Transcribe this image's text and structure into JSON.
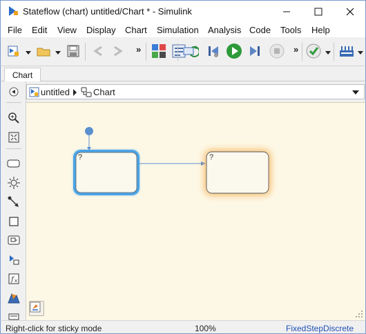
{
  "window": {
    "title": "Stateflow (chart) untitled/Chart * - Simulink",
    "icon": "stateflow-app-icon",
    "controls": [
      "minimize-icon",
      "maximize-icon",
      "close-icon"
    ]
  },
  "menu": {
    "items": [
      "File",
      "Edit",
      "View",
      "Display",
      "Chart",
      "Simulation",
      "Analysis",
      "Code",
      "Tools",
      "Help"
    ]
  },
  "toolbar": {
    "buttons": [
      "new-model-icon",
      "open-folder-icon",
      "save-icon",
      "back-arrow-icon",
      "forward-arrow-icon",
      "library-browser-icon",
      "model-explorer-icon",
      "update-diagram-icon",
      "step-back-icon",
      "run-icon",
      "step-forward-icon",
      "stop-icon",
      "model-advisor-icon",
      "build-icon"
    ],
    "overflow_label": "»"
  },
  "tabs": [
    {
      "label": "Chart",
      "active": true
    }
  ],
  "breadcrumb": {
    "items": [
      {
        "label": "untitled",
        "icon": "model-icon"
      },
      {
        "label": "Chart",
        "icon": "chart-icon"
      }
    ]
  },
  "palette": {
    "tools": [
      "back-navigate-icon",
      "zoom-in-icon",
      "fit-to-view-icon",
      "state-tool-icon",
      "junction-tool-icon",
      "default-transition-tool-icon",
      "box-tool-icon",
      "graphical-function-icon",
      "truth-table-icon",
      "matlab-function-icon",
      "simulink-function-icon",
      "annotation-tool-icon"
    ]
  },
  "canvas": {
    "background": "#fdf8e6",
    "states": [
      {
        "label": "?",
        "highlight": "selected",
        "highlight_color": "#4aa3e6"
      },
      {
        "label": "?",
        "highlight": "active",
        "highlight_color": "#f5a742"
      }
    ],
    "default_transition_color": "#5a8fd0",
    "transition_color": "#5a8fd0"
  },
  "statusbar": {
    "hint": "Right-click for sticky mode",
    "zoom": "100%",
    "solver": "FixedStepDiscrete"
  }
}
